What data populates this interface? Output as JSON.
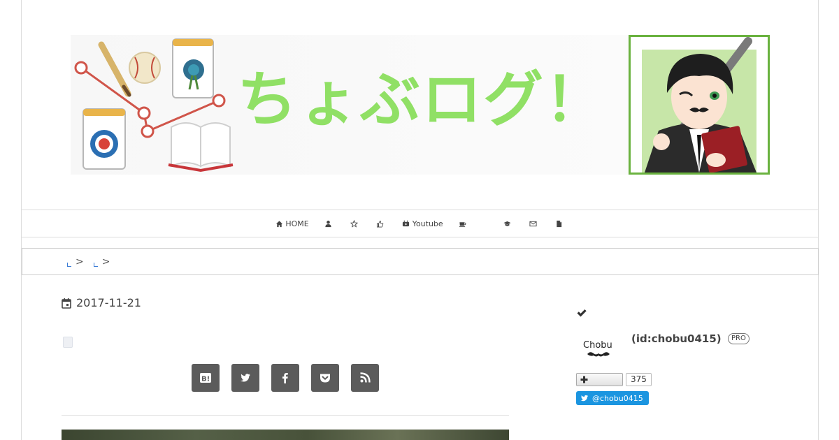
{
  "header": {
    "site_title": "ちょぶログ！",
    "accent_color": "#90e065",
    "portrait_border_color": "#6ab23f"
  },
  "global_nav": {
    "items": [
      {
        "label": "HOME",
        "icon": "home-icon"
      },
      {
        "label": "",
        "icon": "user-icon"
      },
      {
        "label": "",
        "icon": "star-icon"
      },
      {
        "label": "",
        "icon": "thumbs-up-icon"
      },
      {
        "label": "Youtube",
        "icon": "youtube-icon"
      },
      {
        "label": "",
        "icon": "coffee-icon"
      },
      {
        "label": "",
        "icon": "graduation-cap-icon"
      },
      {
        "label": "",
        "icon": "envelope-icon"
      },
      {
        "label": "",
        "icon": "file-icon"
      }
    ]
  },
  "breadcrumb": {
    "separator": ">"
  },
  "article": {
    "date": "2017-11-21",
    "share_buttons": [
      "hatena-bookmark-icon",
      "twitter-icon",
      "facebook-icon",
      "pocket-icon",
      "rss-icon"
    ]
  },
  "sidebar": {
    "profile": {
      "avatar_text": "Chobu",
      "user_id": "(id:chobu0415)",
      "badge": "PRO"
    },
    "follow_count": "375",
    "twitter_handle": "@chobu0415",
    "twitter_color": "#1b95e0"
  }
}
